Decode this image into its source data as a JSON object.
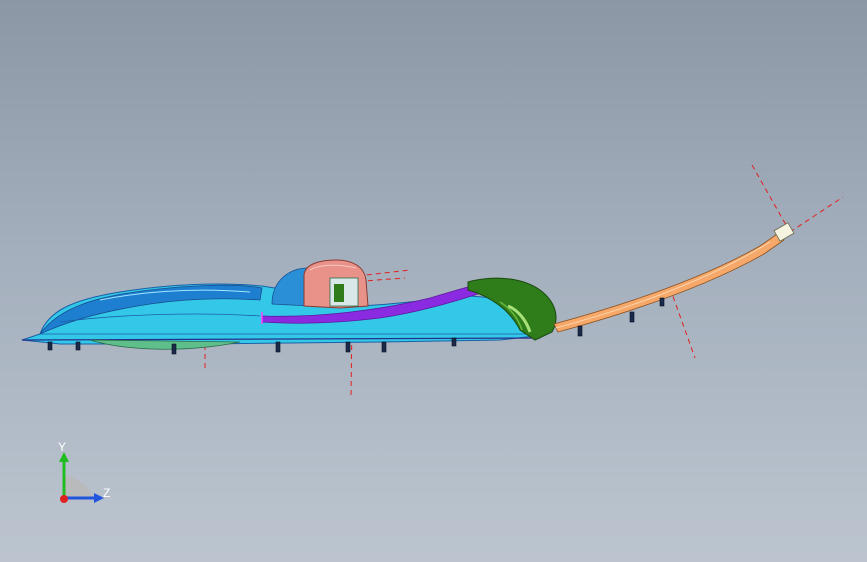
{
  "viewport": {
    "background_top": "#8c97a6",
    "background_bottom": "#bcc5cf"
  },
  "model": {
    "colors": {
      "housing": "#33c8e8",
      "housing_dark": "#1e7fd0",
      "cap": "#e8928a",
      "strip": "#8a2be2",
      "grille": "#2e7d1a",
      "tube": "#f5a86a",
      "centerline": "#e02020"
    }
  },
  "triad": {
    "y_label": "Y",
    "z_label": "Z",
    "y_color": "#22bb22",
    "z_color": "#2255dd",
    "x_color": "#dd2222",
    "icon": "coordinate-triad-icon"
  }
}
